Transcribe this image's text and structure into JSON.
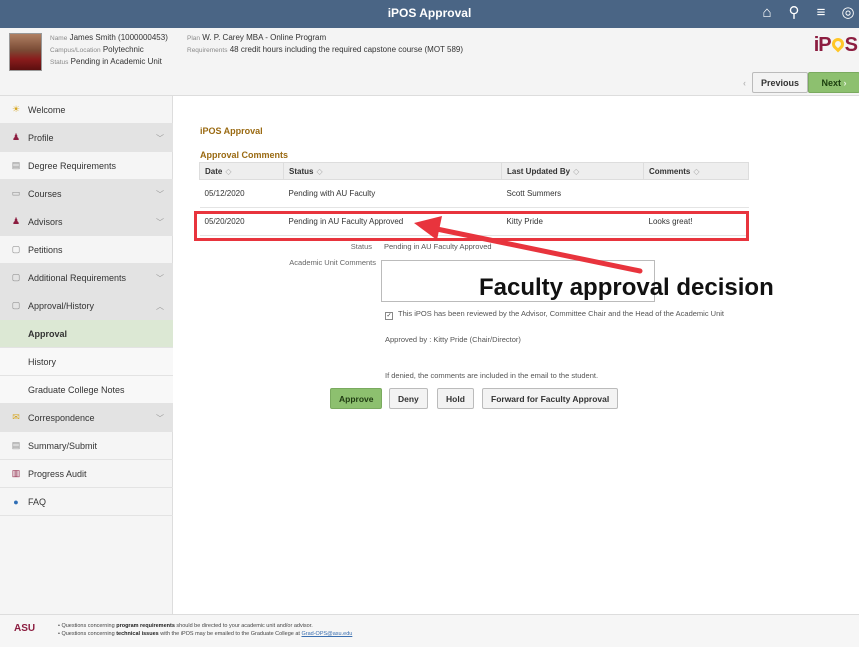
{
  "topbar": {
    "title": "iPOS Approval",
    "icons": [
      "home-icon",
      "search-icon",
      "menu-icon",
      "compass-icon"
    ]
  },
  "student": {
    "name_label": "Name",
    "name": "James Smith (1000000453)",
    "campus_label": "Campus/Location",
    "campus": "Polytechnic",
    "status_label": "Status",
    "status": "Pending in Academic Unit",
    "plan_label": "Plan",
    "plan": "W. P. Carey MBA - Online Program",
    "req_label": "Requirements",
    "requirements": "48 credit hours including the required capstone course (MOT 589)"
  },
  "logo": {
    "pre": "iP",
    "post": "S"
  },
  "nav": {
    "previous": "Previous",
    "next": "Next"
  },
  "sidebar": {
    "items": [
      {
        "label": "Welcome",
        "icon": "sun-icon"
      },
      {
        "label": "Profile",
        "icon": "person-icon"
      },
      {
        "label": "Degree Requirements",
        "icon": "document-icon"
      },
      {
        "label": "Courses",
        "icon": "book-icon"
      },
      {
        "label": "Advisors",
        "icon": "people-icon"
      },
      {
        "label": "Petitions",
        "icon": "form-icon"
      },
      {
        "label": "Additional Requirements",
        "icon": "clipboard-icon"
      },
      {
        "label": "Approval/History",
        "icon": "checklist-icon"
      },
      {
        "label": "Approval"
      },
      {
        "label": "History"
      },
      {
        "label": "Graduate College Notes"
      },
      {
        "label": "Correspondence",
        "icon": "mail-icon"
      },
      {
        "label": "Summary/Submit",
        "icon": "submit-icon"
      },
      {
        "label": "Progress Audit",
        "icon": "chart-icon"
      },
      {
        "label": "FAQ",
        "icon": "help-icon"
      }
    ]
  },
  "main": {
    "section_title": "iPOS Approval",
    "grid_title": "Approval Comments",
    "columns": [
      "Date",
      "Status",
      "Last Updated By",
      "Comments"
    ],
    "rows": [
      {
        "date": "05/12/2020",
        "status": "Pending with AU Faculty",
        "by": "Scott Summers",
        "comments": ""
      },
      {
        "date": "05/20/2020",
        "status": "Pending in AU Faculty Approved",
        "by": "Kitty Pride",
        "comments": "Looks great!"
      }
    ],
    "status_label": "Status",
    "status_value": "Pending in AU Faculty Approved",
    "comments_label": "Academic Unit Comments",
    "checkbox_text": "This iPOS has been reviewed by the Advisor, Committee Chair and the Head of the Academic Unit",
    "approved_by": "Approved by : Kitty Pride (Chair/Director)",
    "deny_note": "If denied, the comments are included in the email to the student.",
    "buttons": {
      "approve": "Approve",
      "deny": "Deny",
      "hold": "Hold",
      "forward": "Forward for Faculty Approval"
    },
    "annotation": "Faculty approval decision",
    "colors": {
      "annotation_box": "#e8343d",
      "approve_button": "#8dc06f"
    }
  },
  "footer": {
    "logo": "ASU",
    "line1_pre": "Questions concerning",
    "line1_bold": "program requirements",
    "line1_post": "should be directed to your academic unit and/or advisor.",
    "line2_pre": "Questions concerning",
    "line2_bold": "technical issues",
    "line2_post": "with the iPOS may be emailed to the Graduate College at",
    "email": "Grad-OPS@asu.edu"
  }
}
